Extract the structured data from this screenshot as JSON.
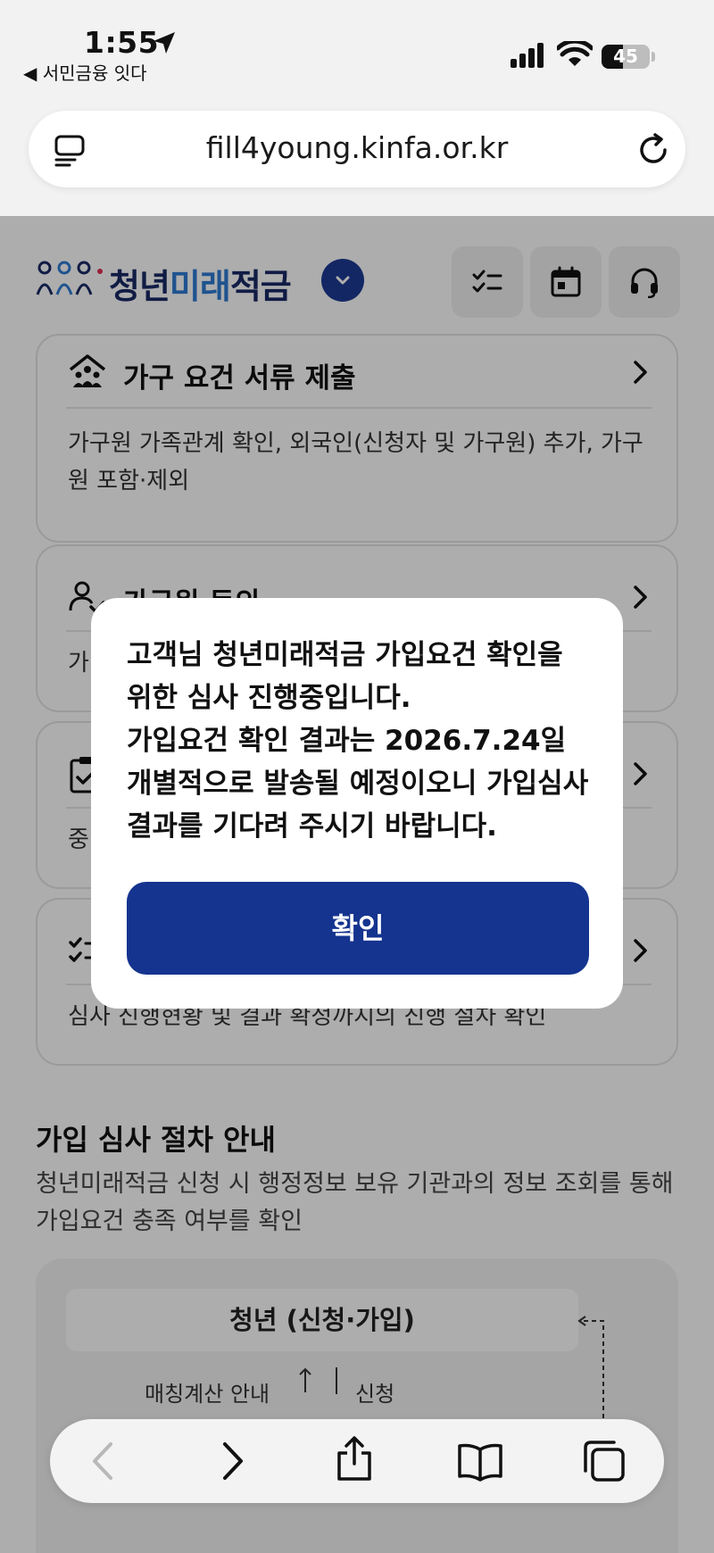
{
  "status_bar": {
    "time": "1:55",
    "back_app": "◀ 서민금융 잇다",
    "battery": "45",
    "battery_level": 0.45,
    "icons": [
      "location-arrow-icon",
      "cellular-signal-icon",
      "wifi-icon",
      "battery-icon"
    ]
  },
  "browser": {
    "url": "fill4young.kinfa.or.kr",
    "icons": [
      "reader-mode-icon",
      "reload-icon"
    ]
  },
  "header": {
    "logo_part1": "청년",
    "logo_part2": "미래",
    "logo_part3": "적금",
    "buttons": [
      "checklist-icon",
      "calendar-icon",
      "headset-icon"
    ]
  },
  "cards": [
    {
      "title": "가구 요건 서류 제출",
      "desc": "가구원 가족관계 확인, 외국인(신청자 및 가구원) 추가, 가구원 포함·제외",
      "icon": "household-icon"
    },
    {
      "title": "가구원 동의",
      "desc": "가",
      "icon": "person-check-icon"
    },
    {
      "title": "",
      "desc": "중",
      "icon": "clipboard-check-icon"
    },
    {
      "title": "",
      "desc": "심사 진행현황 및 결과 확정까지의 진행 절차 확인",
      "icon": "checklist-icon"
    }
  ],
  "section": {
    "title": "가입 심사 절차 안내",
    "desc": "청년미래적금 신청 시 행정정보 보유 기관과의 정보 조회를 통해 가입요건 충족 여부를 확인",
    "flow_label": "청년 (신청·가입)",
    "flow_left": "매칭계산 안내",
    "flow_right": "신청"
  },
  "dialog": {
    "message": "고객님 청년미래적금 가입요건 확인을 위한 심사 진행중입니다.\n가입요건 확인 결과는 2026.7.24일 개별적으로 발송될 예정이오니 가입심사 결과를 기다려 주시기 바랍니다.",
    "confirm_label": "확인"
  },
  "toolbar": {
    "icons": [
      "back-icon",
      "forward-icon",
      "share-icon",
      "bookmarks-icon",
      "tabs-icon"
    ]
  },
  "colors": {
    "primary": "#15348f",
    "logo_dark": "#1a2a66",
    "logo_blue": "#2f7bd3",
    "overlay": "rgba(0,0,0,0.32)"
  }
}
